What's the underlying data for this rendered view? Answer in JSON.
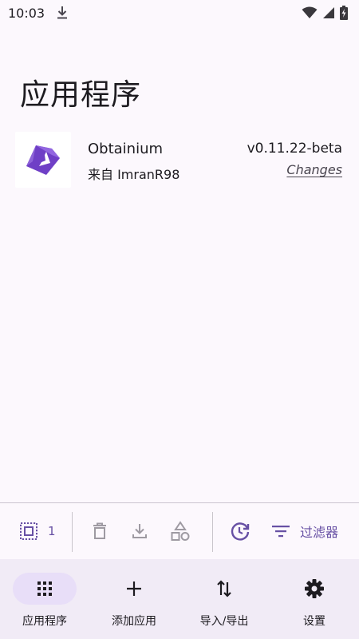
{
  "status_bar": {
    "time": "10:03"
  },
  "page": {
    "title": "应用程序"
  },
  "apps": [
    {
      "name": "Obtainium",
      "source": "来自 ImranR98",
      "version": "v0.11.22-beta",
      "changes_label": "Changes",
      "icon": "obtainium-logo-icon"
    }
  ],
  "action_bar": {
    "selected_count": "1",
    "filter_label": "过滤器"
  },
  "bottom_nav": {
    "items": [
      {
        "label": "应用程序",
        "icon": "apps-grid-icon",
        "active": true
      },
      {
        "label": "添加应用",
        "icon": "plus-icon",
        "active": false
      },
      {
        "label": "导入/导出",
        "icon": "import-export-icon",
        "active": false
      },
      {
        "label": "设置",
        "icon": "gear-icon",
        "active": false
      }
    ]
  },
  "colors": {
    "accent": "#6750a4",
    "background": "#fcf8fd",
    "nav_background": "#f1ebf6",
    "nav_active_pill": "#e8def8",
    "disabled_icon": "#9e9aa2"
  }
}
